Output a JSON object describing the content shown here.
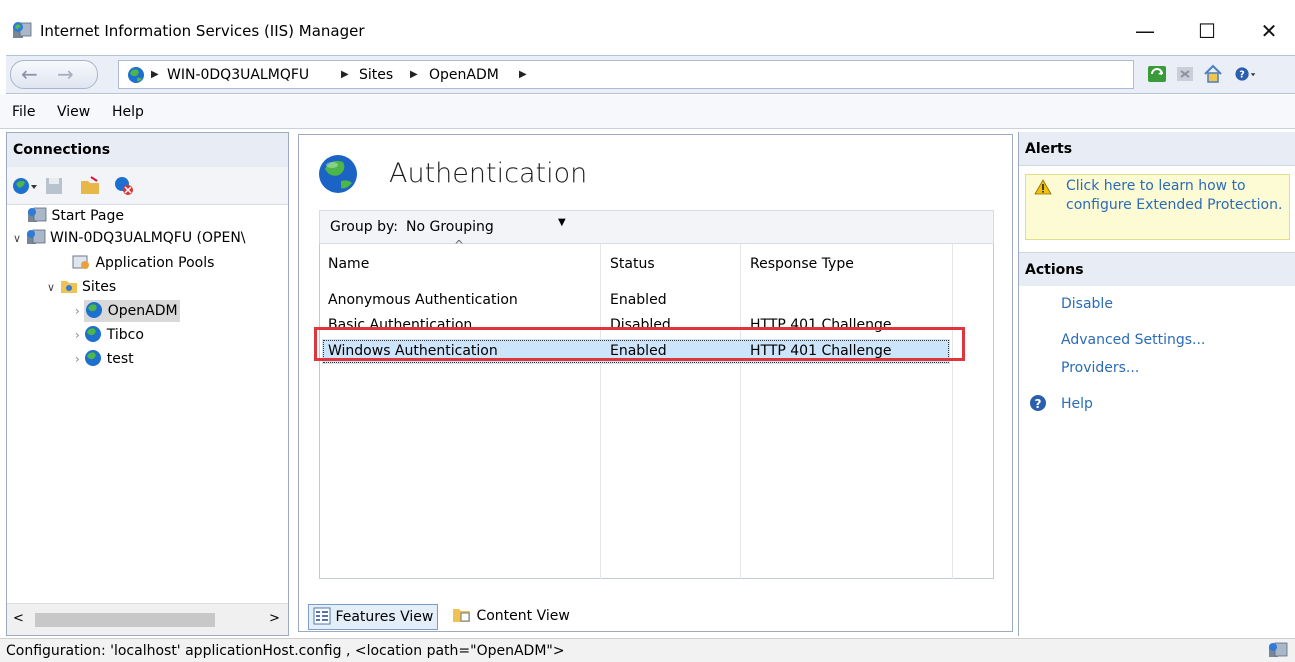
{
  "window": {
    "title": "Internet Information Services (IIS) Manager",
    "minimize_glyph": "—",
    "maximize_glyph": "☐",
    "close_glyph": "✕"
  },
  "address": {
    "back_glyph": "←",
    "forward_glyph": "→",
    "separator_glyph": "▶",
    "crumbs": [
      "WIN-0DQ3UALMQFU",
      "Sites",
      "OpenADM"
    ]
  },
  "menu": {
    "file": "File",
    "view": "View",
    "help": "Help"
  },
  "connections": {
    "header": "Connections",
    "tree": {
      "start_page": "Start Page",
      "server": "WIN-0DQ3UALMQFU (OPEN\\",
      "app_pools": "Application Pools",
      "sites": "Sites",
      "site_openadm": "OpenADM",
      "site_tibco": "Tibco",
      "site_test": "test"
    },
    "scroll_left": "<",
    "scroll_right": ">"
  },
  "main": {
    "title": "Authentication",
    "group_by_label": "Group by:",
    "group_by_value": "No Grouping",
    "columns": {
      "name": "Name",
      "status": "Status",
      "response": "Response Type"
    },
    "rows": [
      {
        "name": "Anonymous Authentication",
        "status": "Enabled",
        "response": ""
      },
      {
        "name": "Basic Authentication",
        "status": "Disabled",
        "response": "HTTP 401 Challenge"
      },
      {
        "name": "Windows Authentication",
        "status": "Enabled",
        "response": "HTTP 401 Challenge"
      }
    ],
    "tabs": {
      "features": "Features View",
      "content": "Content View"
    }
  },
  "alerts": {
    "header": "Alerts",
    "message": "Click here to learn how to configure Extended Protection."
  },
  "actions": {
    "header": "Actions",
    "disable": "Disable",
    "advanced": "Advanced Settings...",
    "providers": "Providers...",
    "help": "Help"
  },
  "status": {
    "text": "Configuration: 'localhost' applicationHost.config , <location path=\"OpenADM\">"
  },
  "colors": {
    "highlight_border": "#e0353b",
    "selected_row": "#cde5fa",
    "link": "#2a6cb8",
    "alert_background": "#fdfbd3"
  }
}
